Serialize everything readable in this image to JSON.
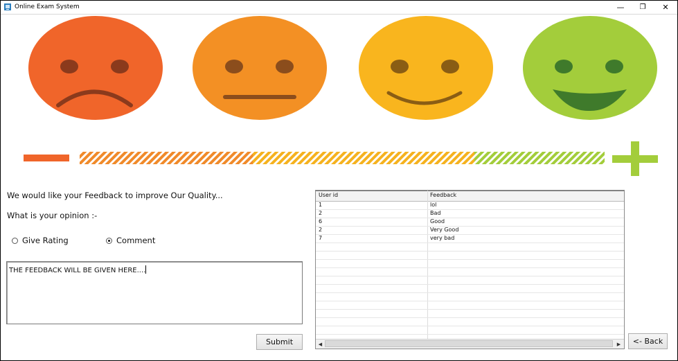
{
  "window": {
    "title": "Online Exam System",
    "min_glyph": "—",
    "max_glyph": "❐",
    "close_glyph": "✕"
  },
  "colors": {
    "sad": "#f0652a",
    "neutral": "#f39024",
    "happy": "#f9b51e",
    "very_happy": "#a3cd3b"
  },
  "form": {
    "intro": "We would like your Feedback to improve Our Quality...",
    "question": "What is your opinion  :-",
    "radio_rating": "Give Rating",
    "radio_comment": "Comment",
    "selected": "Comment",
    "feedback_text": "THE FEEDBACK WILL BE GIVEN HERE....",
    "submit_label": "Submit",
    "back_label": "<- Back"
  },
  "table": {
    "columns": [
      "User id",
      "Feedback"
    ],
    "rows": [
      [
        "1",
        "lol"
      ],
      [
        "2",
        "Bad"
      ],
      [
        "6",
        "Good"
      ],
      [
        "2",
        "Very Good"
      ],
      [
        "7",
        "very bad"
      ]
    ],
    "scroll_left": "◀",
    "scroll_right": "▶"
  }
}
